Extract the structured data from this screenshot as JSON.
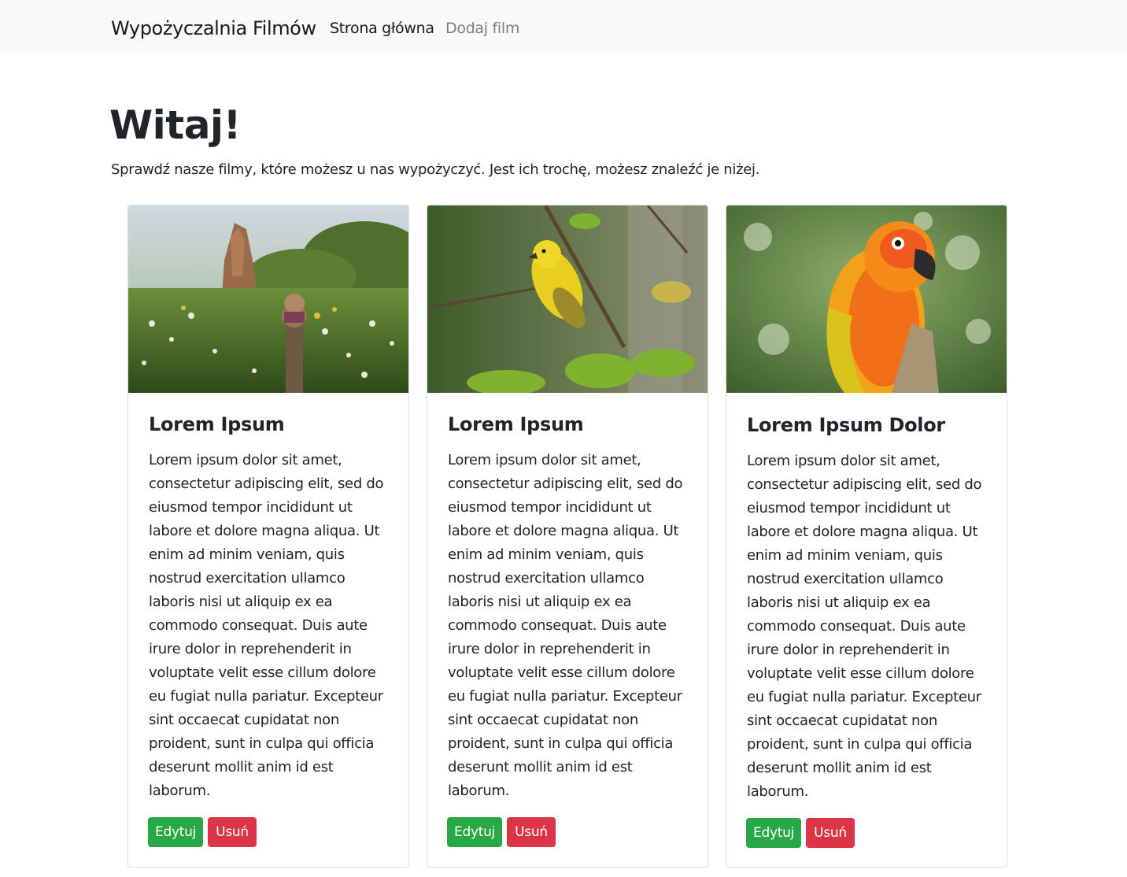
{
  "navbar": {
    "brand": "Wypożyczalnia Filmów",
    "links": [
      {
        "label": "Strona główna"
      },
      {
        "label": "Dodaj film"
      }
    ]
  },
  "hero": {
    "title": "Witaj!",
    "lead": "Sprawdź nasze filmy, które możesz u nas wypożyczyć. Jest ich trochę, możesz znaleźć je niżej."
  },
  "cards": [
    {
      "title": "Lorem Ipsum",
      "text": "Lorem ipsum dolor sit amet, consectetur adipiscing elit, sed do eiusmod tempor incididunt ut labore et dolore magna aliqua. Ut enim ad minim veniam, quis nostrud exercitation ullamco laboris nisi ut aliquip ex ea commodo consequat. Duis aute irure dolor in reprehenderit in voluptate velit esse cillum dolore eu fugiat nulla pariatur. Excepteur sint occaecat cupidatat non proident, sunt in culpa qui officia deserunt mollit anim id est laborum.",
      "edit_label": "Edytuj",
      "delete_label": "Usuń",
      "image": "meadow-ruin-photo"
    },
    {
      "title": "Lorem Ipsum",
      "text": "Lorem ipsum dolor sit amet, consectetur adipiscing elit, sed do eiusmod tempor incididunt ut labore et dolore magna aliqua. Ut enim ad minim veniam, quis nostrud exercitation ullamco laboris nisi ut aliquip ex ea commodo consequat. Duis aute irure dolor in reprehenderit in voluptate velit esse cillum dolore eu fugiat nulla pariatur. Excepteur sint occaecat cupidatat non proident, sunt in culpa qui officia deserunt mollit anim id est laborum.",
      "edit_label": "Edytuj",
      "delete_label": "Usuń",
      "image": "yellow-bird-photo"
    },
    {
      "title": "Lorem Ipsum Dolor",
      "text": "Lorem ipsum dolor sit amet, consectetur adipiscing elit, sed do eiusmod tempor incididunt ut labore et dolore magna aliqua. Ut enim ad minim veniam, quis nostrud exercitation ullamco laboris nisi ut aliquip ex ea commodo consequat. Duis aute irure dolor in reprehenderit in voluptate velit esse cillum dolore eu fugiat nulla pariatur. Excepteur sint occaecat cupidatat non proident, sunt in culpa qui officia deserunt mollit anim id est laborum.",
      "edit_label": "Edytuj",
      "delete_label": "Usuń",
      "image": "orange-parrot-photo"
    }
  ],
  "colors": {
    "navbar_bg": "#f8f9fa",
    "edit_button": "#28a745",
    "delete_button": "#dc3545",
    "text": "#212529"
  }
}
